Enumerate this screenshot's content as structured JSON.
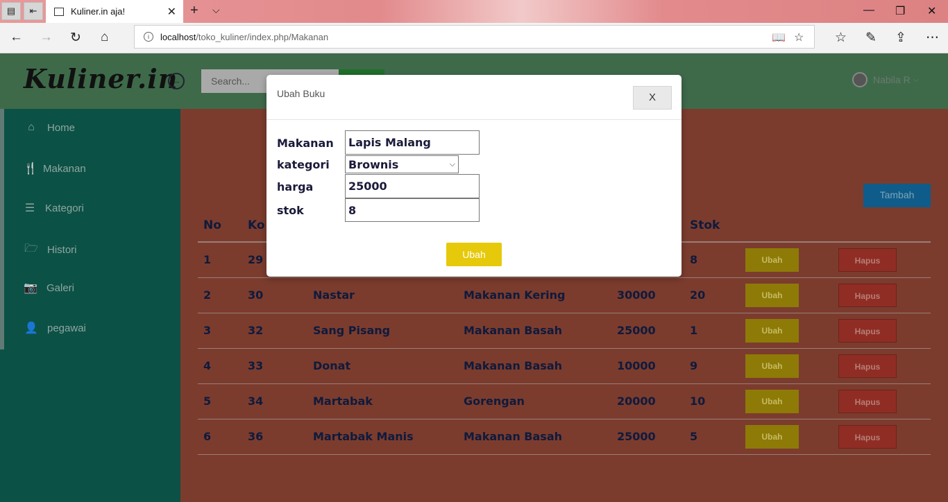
{
  "browser": {
    "tab_title": "Kuliner.in aja!",
    "url_host": "localhost",
    "url_path": "/toko_kuliner/index.php/Makanan"
  },
  "header": {
    "logo": "Kuliner.in",
    "search_placeholder": "Search...",
    "user_name": "Nabila R"
  },
  "sidebar": {
    "items": [
      {
        "label": "Home",
        "icon": "home-icon"
      },
      {
        "label": "Makanan",
        "icon": "cutlery-icon"
      },
      {
        "label": "Kategori",
        "icon": "menu-icon"
      },
      {
        "label": "Histori",
        "icon": "folder-icon"
      },
      {
        "label": "Galeri",
        "icon": "camera-icon"
      },
      {
        "label": "pegawai",
        "icon": "user-icon"
      }
    ]
  },
  "main": {
    "add_button": "Tambah",
    "table": {
      "headers": [
        "No",
        "Ko",
        "",
        "",
        "",
        "Stok",
        "",
        ""
      ],
      "rows": [
        {
          "no": "1",
          "kode": "29",
          "nama": "",
          "kategori": "",
          "harga": "",
          "stok": "8"
        },
        {
          "no": "2",
          "kode": "30",
          "nama": "Nastar",
          "kategori": "Makanan Kering",
          "harga": "30000",
          "stok": "20"
        },
        {
          "no": "3",
          "kode": "32",
          "nama": "Sang Pisang",
          "kategori": "Makanan Basah",
          "harga": "25000",
          "stok": "1"
        },
        {
          "no": "4",
          "kode": "33",
          "nama": "Donat",
          "kategori": "Makanan Basah",
          "harga": "10000",
          "stok": "9"
        },
        {
          "no": "5",
          "kode": "34",
          "nama": "Martabak",
          "kategori": "Gorengan",
          "harga": "20000",
          "stok": "10"
        },
        {
          "no": "6",
          "kode": "36",
          "nama": "Martabak Manis",
          "kategori": "Makanan Basah",
          "harga": "25000",
          "stok": "5"
        }
      ],
      "edit_label": "Ubah",
      "delete_label": "Hapus"
    }
  },
  "modal": {
    "title": "Ubah Buku",
    "close_label": "X",
    "labels": {
      "makanan": "Makanan",
      "kategori": "kategori",
      "harga": "harga",
      "stok": "stok"
    },
    "values": {
      "makanan": "Lapis Malang",
      "kategori": "Brownis",
      "harga": "25000",
      "stok": "8"
    },
    "submit_label": "Ubah"
  },
  "colors": {
    "header_bg": "#3e6a4a",
    "sidebar_bg": "#0c5146",
    "content_bg": "#7b3c2e",
    "edit_button": "#8e7a07",
    "delete_button": "#8f2d24",
    "submit_button": "#e6c90b"
  }
}
